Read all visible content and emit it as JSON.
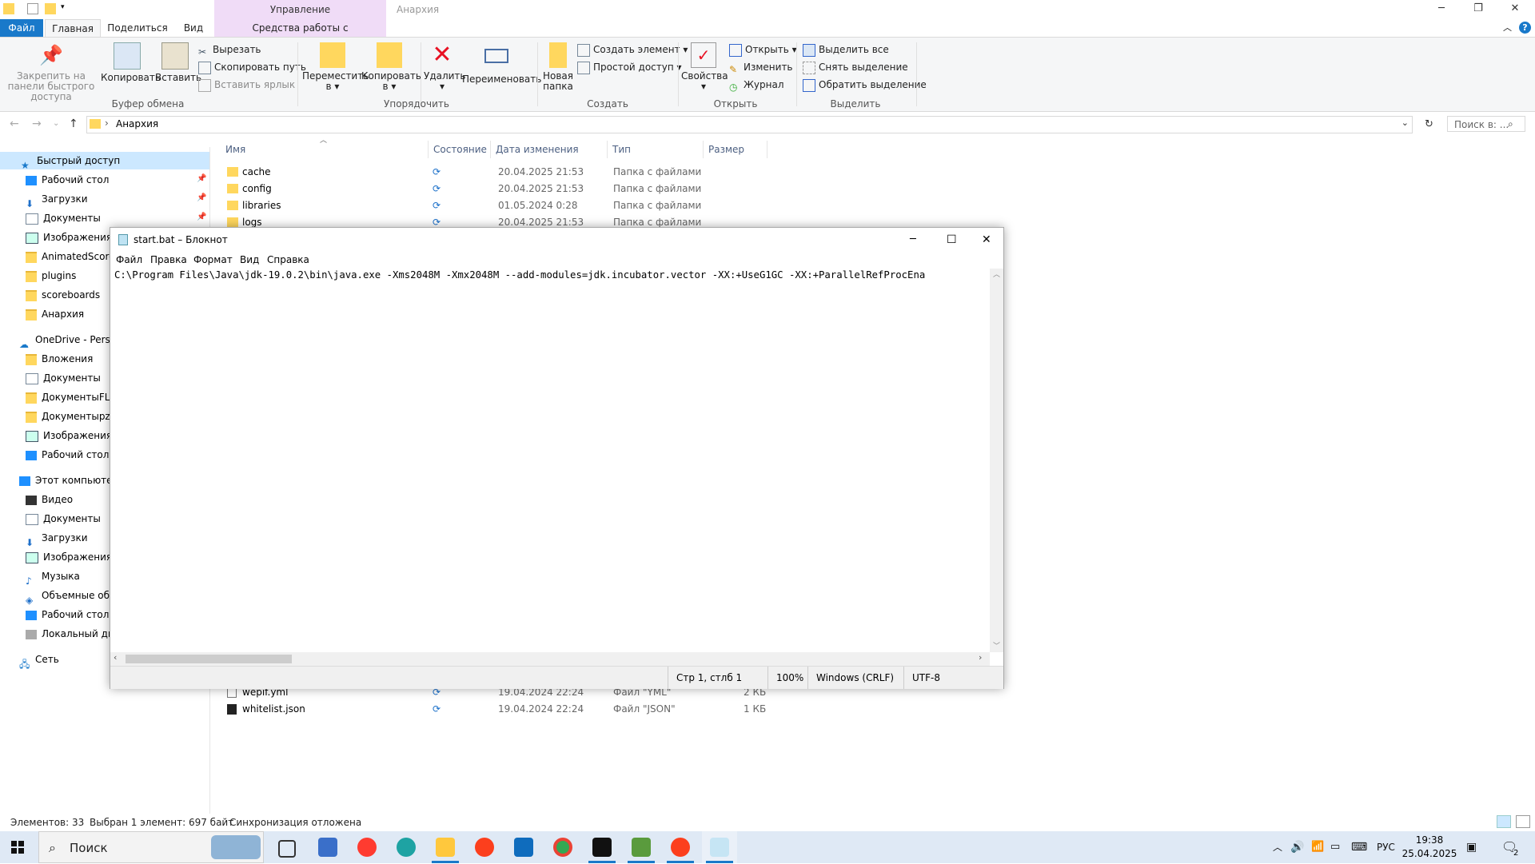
{
  "explorer": {
    "context_tab": "Управление",
    "context_subtab": "Средства работы с приложениями",
    "title": "Анархия",
    "tabs": [
      "Файл",
      "Главная",
      "Поделиться",
      "Вид"
    ],
    "ribbon": {
      "pin_quick": "Закрепить на панели быстрого доступа",
      "copy": "Копировать",
      "paste": "Вставить",
      "cut": "Вырезать",
      "copy_path": "Скопировать путь",
      "paste_shortcut": "Вставить ярлык",
      "group_clipboard": "Буфер обмена",
      "move_to": "Переместить в",
      "copy_to": "Копировать в",
      "delete": "Удалить",
      "rename": "Переименовать",
      "group_organize": "Упорядочить",
      "new_folder": "Новая папка",
      "new_item": "Создать элемент",
      "easy_access": "Простой доступ",
      "group_new": "Создать",
      "properties": "Свойства",
      "open": "Открыть",
      "edit": "Изменить",
      "history": "Журнал",
      "group_open": "Открыть",
      "select_all": "Выделить все",
      "select_none": "Снять выделение",
      "invert_selection": "Обратить выделение",
      "group_select": "Выделить"
    },
    "address": {
      "path": "Анархия",
      "search_placeholder": "Поиск в: ..."
    },
    "nav": {
      "quick_access": "Быстрый доступ",
      "quick_items": [
        "Рабочий стол",
        "Загрузки",
        "Документы",
        "Изображения",
        "AnimatedScoreb",
        "plugins",
        "scoreboards",
        "Анархия"
      ],
      "onedrive": "OneDrive - Persor",
      "onedrive_items": [
        "Вложения",
        "Документы",
        "ДокументыFL S",
        "ДокументыpzLa",
        "Изображения",
        "Рабочий стол"
      ],
      "this_pc": "Этот компьютер",
      "pc_items": [
        "Видео",
        "Документы",
        "Загрузки",
        "Изображения",
        "Музыка",
        "Объемные объ",
        "Рабочий стол",
        "Локальный дис"
      ],
      "network": "Сеть"
    },
    "columns": [
      "Имя",
      "Состояние",
      "Дата изменения",
      "Тип",
      "Размер"
    ],
    "files_top": [
      {
        "name": "cache",
        "state": "⟳",
        "date": "20.04.2025 21:53",
        "type": "Папка с файлами",
        "size": ""
      },
      {
        "name": "config",
        "state": "⟳",
        "date": "20.04.2025 21:53",
        "type": "Папка с файлами",
        "size": ""
      },
      {
        "name": "libraries",
        "state": "⟳",
        "date": "01.05.2024 0:28",
        "type": "Папка с файлами",
        "size": ""
      },
      {
        "name": "logs",
        "state": "⟳",
        "date": "20.04.2025 21:53",
        "type": "Папка с файлами",
        "size": ""
      }
    ],
    "files_bottom": [
      {
        "name": "wepif.yml",
        "state": "⟳",
        "date": "19.04.2024 22:24",
        "type": "Файл \"YML\"",
        "size": "2 КБ"
      },
      {
        "name": "whitelist.json",
        "state": "⟳",
        "date": "19.04.2024 22:24",
        "type": "Файл \"JSON\"",
        "size": "1 КБ"
      }
    ],
    "status": {
      "count": "Элементов: 33",
      "selected": "Выбран 1 элемент: 697 байт",
      "sync": "Синхронизация отложена"
    }
  },
  "notepad": {
    "title": "start.bat – Блокнот",
    "menu": [
      "Файл",
      "Правка",
      "Формат",
      "Вид",
      "Справка"
    ],
    "content": "C:\\Program Files\\Java\\jdk-19.0.2\\bin\\java.exe -Xms2048M -Xmx2048M --add-modules=jdk.incubator.vector -XX:+UseG1GC -XX:+ParallelRefProcEna",
    "status": {
      "position": "Стр 1, стлб 1",
      "zoom": "100%",
      "eol": "Windows (CRLF)",
      "encoding": "UTF-8"
    }
  },
  "taskbar": {
    "search": "Поиск",
    "lang": "РУС",
    "time": "19:38",
    "date": "25.04.2025",
    "notif_count": "2"
  },
  "colors": {
    "file_tab": "#1979ca",
    "context_tab": "#f0dcf7",
    "selection": "#cce8ff",
    "taskbar": "#dfe9f5"
  }
}
